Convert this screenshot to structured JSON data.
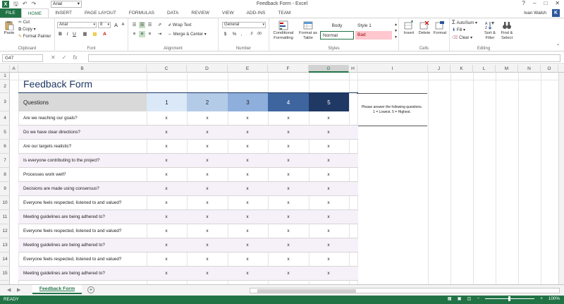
{
  "window": {
    "title": "Feedback Form - Excel",
    "qat_font": "Arial",
    "controls": [
      "?",
      "–",
      "□",
      "✕"
    ]
  },
  "tabs": [
    "FILE",
    "HOME",
    "INSERT",
    "PAGE LAYOUT",
    "FORMULAS",
    "DATA",
    "REVIEW",
    "VIEW",
    "ADD-INS",
    "TEAM"
  ],
  "active_tab": "HOME",
  "user": {
    "name": "Ivan Walsh",
    "initial": "K"
  },
  "ribbon": {
    "clipboard": {
      "label": "Clipboard",
      "paste": "Paste",
      "cut": "Cut",
      "copy": "Copy",
      "format_painter": "Format Painter"
    },
    "font": {
      "label": "Font",
      "name": "Arial",
      "size": "8",
      "bold": "B",
      "italic": "I",
      "underline": "U",
      "grow": "A",
      "shrink": "A"
    },
    "alignment": {
      "label": "Alignment",
      "wrap": "Wrap Text",
      "merge": "Merge & Center"
    },
    "number": {
      "label": "Number",
      "format": "General",
      "currency": "$",
      "percent": "%",
      "comma": ","
    },
    "styles": {
      "label": "Styles",
      "conditional": "Conditional Formatting",
      "format_table": "Format as Table",
      "body": "Body",
      "style1": "Style 1",
      "normal": "Normal",
      "bad": "Bad"
    },
    "cells": {
      "label": "Cells",
      "insert": "Insert",
      "delete": "Delete",
      "format": "Format"
    },
    "editing": {
      "label": "Editing",
      "autosum": "AutoSum",
      "fill": "Fill",
      "clear": "Clear",
      "sort": "Sort & Filter",
      "find": "Find & Select"
    }
  },
  "formula_bar": {
    "namebox": "G47",
    "icons": [
      "✕",
      "✓",
      "fx"
    ],
    "value": ""
  },
  "columns": [
    "A",
    "B",
    "C",
    "D",
    "E",
    "F",
    "G",
    "H",
    "I",
    "J",
    "K",
    "L",
    "M",
    "N",
    "O"
  ],
  "selected_column": "G",
  "rows": [
    "1",
    "2",
    "3",
    "4",
    "5",
    "6",
    "7",
    "8",
    "9",
    "10",
    "11",
    "12",
    "13",
    "14",
    "15"
  ],
  "form": {
    "title": "Feedback Form",
    "header": {
      "questions": "Questions",
      "scores": [
        "1",
        "2",
        "3",
        "4",
        "5"
      ]
    },
    "note": {
      "line1": "Please answer the following questions.",
      "line2": "1 = Lowest. 5 = Highest."
    },
    "mark": "x",
    "questions": [
      "Are we reaching our goals?",
      "Do we have clear directions?",
      "Are our targets realistic?",
      "Is everyone contributing to the project?",
      "Processes work well?",
      "Decisions are made using consensus?",
      "Everyone feels respected, listened to and valued?",
      "Meeting guidelines are being adhered to?",
      "Everyone feels respected, listened to and valued?",
      "Meeting guidelines are being adhered to?",
      "Everyone feels respected, listened to and valued?",
      "Meeting guidelines are being adhered to?"
    ]
  },
  "sheet_tabs": {
    "active": "Feedback Form",
    "add": "+"
  },
  "status": {
    "ready": "READY",
    "zoom": "100%"
  }
}
